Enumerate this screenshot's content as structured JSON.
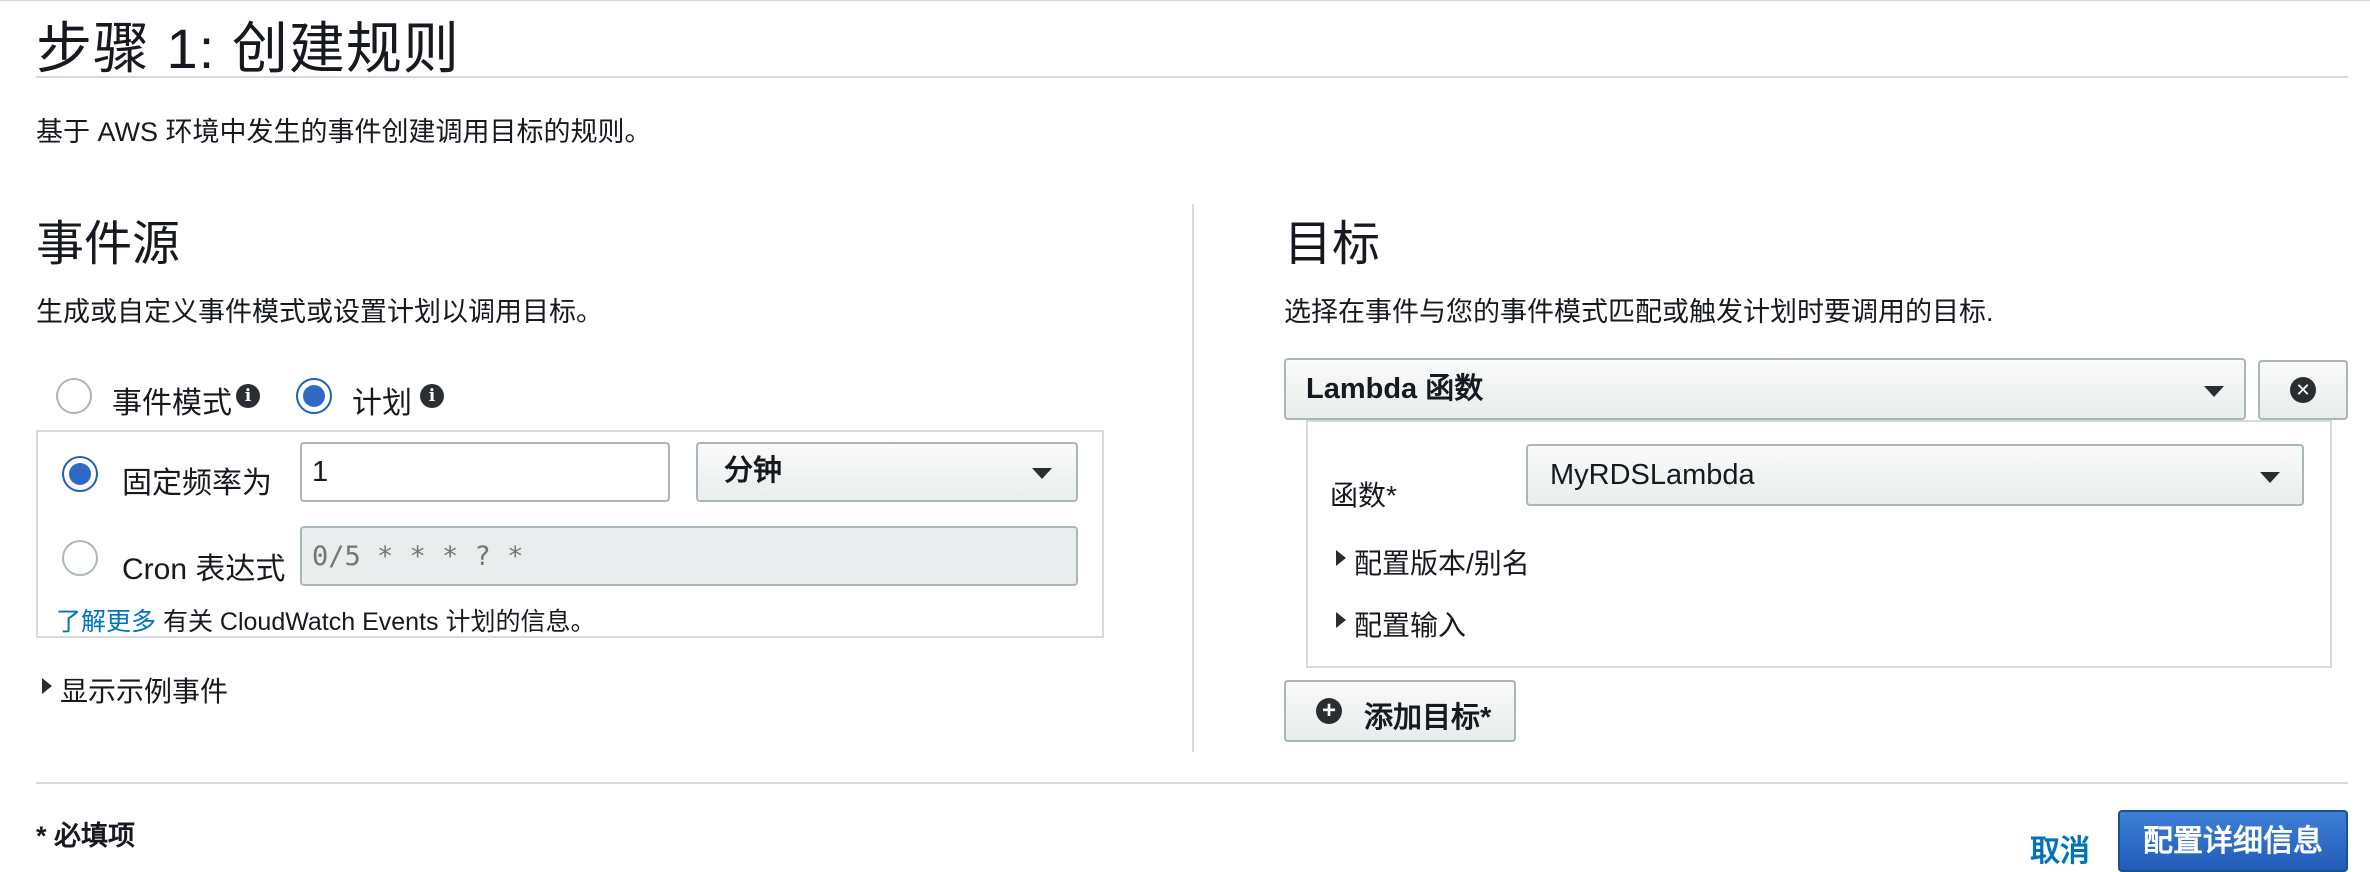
{
  "page": {
    "title": "步骤 1: 创建规则",
    "description": "基于 AWS 环境中发生的事件创建调用目标的规则。"
  },
  "event_source": {
    "heading": "事件源",
    "description": "生成或自定义事件模式或设置计划以调用目标。",
    "modes": {
      "event_pattern_label": "事件模式",
      "schedule_label": "计划",
      "selected": "schedule"
    },
    "schedule": {
      "fixed_rate_label": "固定频率为",
      "fixed_rate_value": "1",
      "unit_value": "分钟",
      "cron_label": "Cron 表达式",
      "cron_placeholder": "0/5 * * * ? *",
      "selected": "fixed_rate",
      "learn_more_link": "了解更多",
      "learn_more_text": "有关 CloudWatch Events 计划的信息。"
    },
    "show_sample_events": "显示示例事件"
  },
  "targets": {
    "heading": "目标",
    "description": "选择在事件与您的事件模式匹配或触发计划时要调用的目标.",
    "target_type": "Lambda 函数",
    "function_label": "函数*",
    "function_value": "MyRDSLambda",
    "configure_version": "配置版本/别名",
    "configure_input": "配置输入",
    "add_target": "添加目标*"
  },
  "footer": {
    "required_note": "* 必填项",
    "cancel": "取消",
    "configure_details": "配置详细信息"
  },
  "colors": {
    "primary": "#2e6ac4",
    "link": "#0073bb",
    "border": "#d5dbdb"
  }
}
